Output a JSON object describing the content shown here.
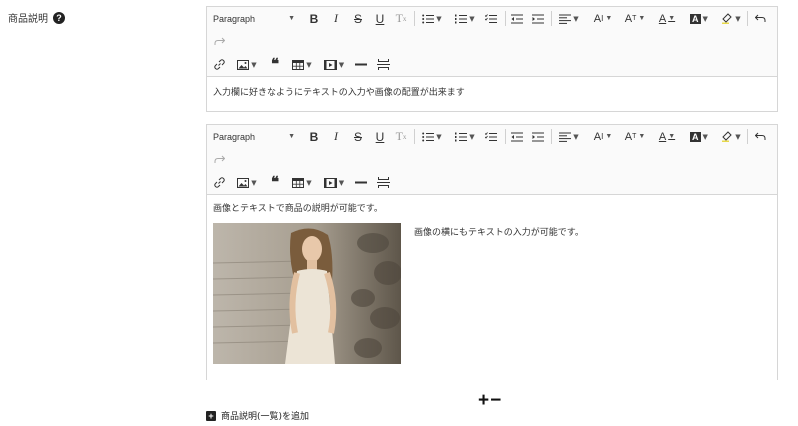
{
  "field": {
    "label": "商品説明",
    "help": "?"
  },
  "toolbar": {
    "paragraph": "Paragraph"
  },
  "editor1": {
    "text": "入力欄に好きなようにテキストの入力や画像の配置が出来ます"
  },
  "editor2": {
    "line1": "画像とテキストで商品の説明が可能です。",
    "side_text": "画像の横にもテキストの入力が可能です。"
  },
  "controls": {
    "plus": "+",
    "minus": "−"
  },
  "add": {
    "icon": "+",
    "label": "商品説明(一覧)を追加"
  }
}
